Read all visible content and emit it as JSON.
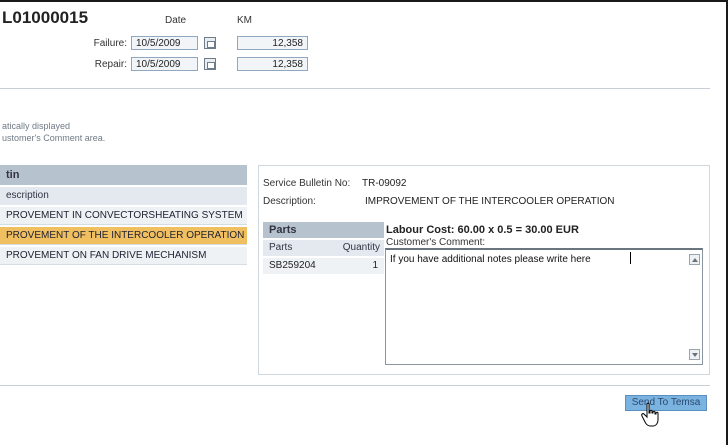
{
  "header": {
    "doc_id": "L01000015",
    "date_header": "Date",
    "km_header": "KM",
    "failure_label": "Failure:",
    "failure_date": "10/5/2009",
    "failure_km": "12,358",
    "repair_label": "Repair:",
    "repair_date": "10/5/2009",
    "repair_km": "12,358"
  },
  "hint": {
    "line1": "atically displayed",
    "line2": "ustomer's Comment area."
  },
  "bulletin_list": {
    "title": "tin",
    "column": "escription",
    "items": [
      {
        "label": "PROVEMENT IN CONVECTORSHEATING SYSTEM",
        "selected": false
      },
      {
        "label": "PROVEMENT OF THE INTERCOOLER OPERATION",
        "selected": true
      },
      {
        "label": "PROVEMENT ON FAN DRIVE MECHANISM",
        "selected": false
      }
    ]
  },
  "detail": {
    "sb_label": "Service Bulletin No:",
    "sb_value": "TR-09092",
    "desc_label": "Description:",
    "desc_value": "IMPROVEMENT OF THE INTERCOOLER OPERATION",
    "parts_title": "Parts",
    "parts_col_parts": "Parts",
    "parts_col_qty": "Quantity",
    "part_no": "SB259204",
    "part_qty": "1",
    "labour_cost": "Labour Cost:  60.00 x  0.5 =  30.00 EUR",
    "comment_label": "Customer's Comment:",
    "comment_text": "If you have additional notes please write here"
  },
  "actions": {
    "send_label": "Send To Temsa"
  },
  "colors": {
    "accent": "#7ab2e0",
    "selected_row": "#f0c060",
    "panel_header": "#b6c2ce"
  }
}
